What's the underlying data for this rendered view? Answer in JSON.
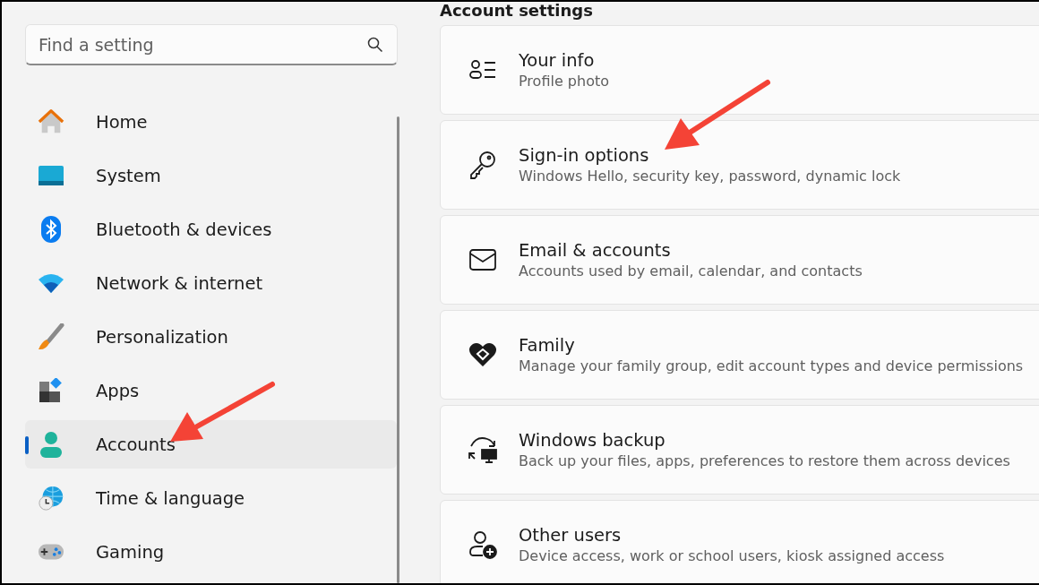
{
  "search": {
    "placeholder": "Find a setting"
  },
  "sidebar": {
    "items": [
      {
        "label": "Home",
        "selected": false
      },
      {
        "label": "System",
        "selected": false
      },
      {
        "label": "Bluetooth & devices",
        "selected": false
      },
      {
        "label": "Network & internet",
        "selected": false
      },
      {
        "label": "Personalization",
        "selected": false
      },
      {
        "label": "Apps",
        "selected": false
      },
      {
        "label": "Accounts",
        "selected": true
      },
      {
        "label": "Time & language",
        "selected": false
      },
      {
        "label": "Gaming",
        "selected": false
      }
    ]
  },
  "section": {
    "title": "Account settings",
    "items": [
      {
        "title": "Your info",
        "subtitle": "Profile photo"
      },
      {
        "title": "Sign-in options",
        "subtitle": "Windows Hello, security key, password, dynamic lock"
      },
      {
        "title": "Email & accounts",
        "subtitle": "Accounts used by email, calendar, and contacts"
      },
      {
        "title": "Family",
        "subtitle": "Manage your family group, edit account types and device permissions"
      },
      {
        "title": "Windows backup",
        "subtitle": "Back up your files, apps, preferences to restore them across devices"
      },
      {
        "title": "Other users",
        "subtitle": "Device access, work or school users, kiosk assigned access"
      }
    ]
  }
}
